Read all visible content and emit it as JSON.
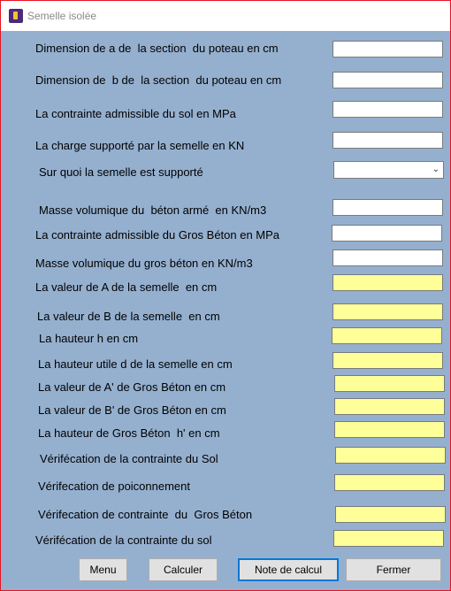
{
  "window": {
    "title": "Semelle isolée"
  },
  "form": {
    "a_poteau_label": "Dimension de a de  la section  du poteau en cm",
    "b_poteau_label": "Dimension de  b de  la section  du poteau en cm",
    "contrainte_sol_label": "La contrainte admissible du sol en MPa",
    "charge_label": "La charge supporté par la semelle en KN",
    "support_label": "Sur quoi la semelle est supporté",
    "support_value": "",
    "masse_beton_arme_label": "Masse volumique du  béton armé  en KN/m3",
    "contrainte_gros_beton_label": "La contrainte admissible du Gros Béton en MPa",
    "masse_gros_beton_label": "Masse volumique du gros béton en KN/m3",
    "valeur_A_label": "La valeur de A de la semelle  en cm",
    "valeur_B_label": "La valeur de B de la semelle  en cm",
    "hauteur_h_label": "La hauteur h en cm",
    "hauteur_utile_label": "La hauteur utile d de la semelle en cm",
    "valeur_A_gros_label": "La valeur de A' de Gros Béton en cm",
    "valeur_B_gros_label": "La valeur de B' de Gros Béton en cm",
    "hauteur_gros_label": "La hauteur de Gros Béton  h' en cm",
    "verif_contrainte_sol_label": "Vérifécation de la contrainte du Sol",
    "verif_poinconnement_label": "Vérifecation de poiconnement",
    "verif_contrainte_gros_label": "Vérifecation de contrainte  du  Gros Béton",
    "verif_contrainte_sol2_label": "Vérifécation de la contrainte du sol"
  },
  "buttons": {
    "menu": "Menu",
    "calculer": "Calculer",
    "note": "Note de calcul",
    "fermer": "Fermer"
  },
  "colors": {
    "background": "#95b0cf",
    "result_field": "#ffff99",
    "focus_border": "#0078d7",
    "window_border": "#e81123"
  }
}
